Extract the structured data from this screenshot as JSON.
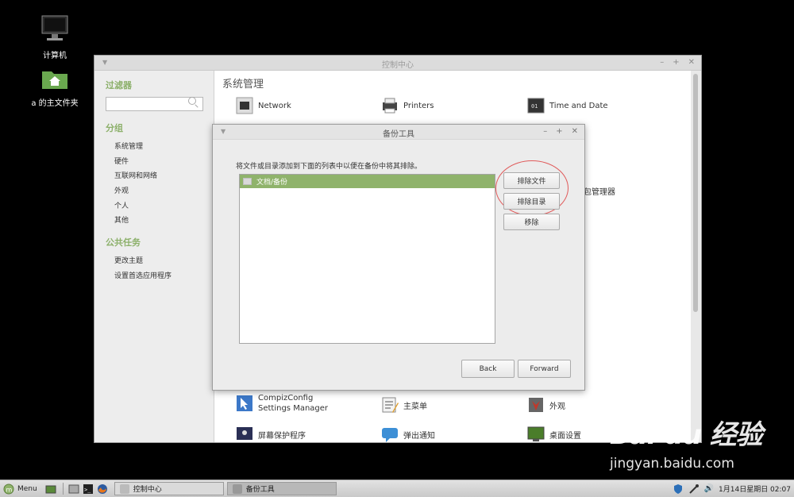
{
  "desktop": {
    "icons": [
      {
        "label": "计算机"
      },
      {
        "label": "a 的主文件夹"
      }
    ]
  },
  "control_center": {
    "title": "控制中心",
    "sidebar": {
      "filter_heading": "过滤器",
      "search_value": "",
      "groups_heading": "分组",
      "groups": [
        "系统管理",
        "硬件",
        "互联网和网络",
        "外观",
        "个人",
        "其他"
      ],
      "tasks_heading": "公共任务",
      "tasks": [
        "更改主题",
        "设置首选应用程序"
      ]
    },
    "section_title": "系统管理",
    "apps": {
      "network": "Network",
      "printers": "Printers",
      "time_date": "Time and Date",
      "package_manager_partial": "包管理器",
      "compiz": "CompizConfig Settings Manager",
      "main_menu": "主菜单",
      "appearance": "外观",
      "screensaver": "屏幕保护程序",
      "popup_notify": "弹出通知",
      "desktop_settings": "桌面设置"
    }
  },
  "backup_dialog": {
    "title": "备份工具",
    "instruction": "将文件或目录添加到下面的列表中以便在备份中将其排除。",
    "list_items": [
      "文档/备份"
    ],
    "buttons": {
      "exclude_file": "排除文件",
      "exclude_dir": "排除目录",
      "remove": "移除",
      "back": "Back",
      "forward": "Forward"
    }
  },
  "taskbar": {
    "menu_label": "Menu",
    "windows": [
      {
        "label": "控制中心",
        "active": false
      },
      {
        "label": "备份工具",
        "active": true
      }
    ],
    "clock": "1月14日星期日 02:07"
  },
  "watermark": {
    "brand": "Bai du 经验",
    "url": "jingyan.baidu.com"
  },
  "colors": {
    "accent_green": "#8fb36b",
    "heading_green": "#8cb06a",
    "annotation_red": "#e05a5a"
  }
}
